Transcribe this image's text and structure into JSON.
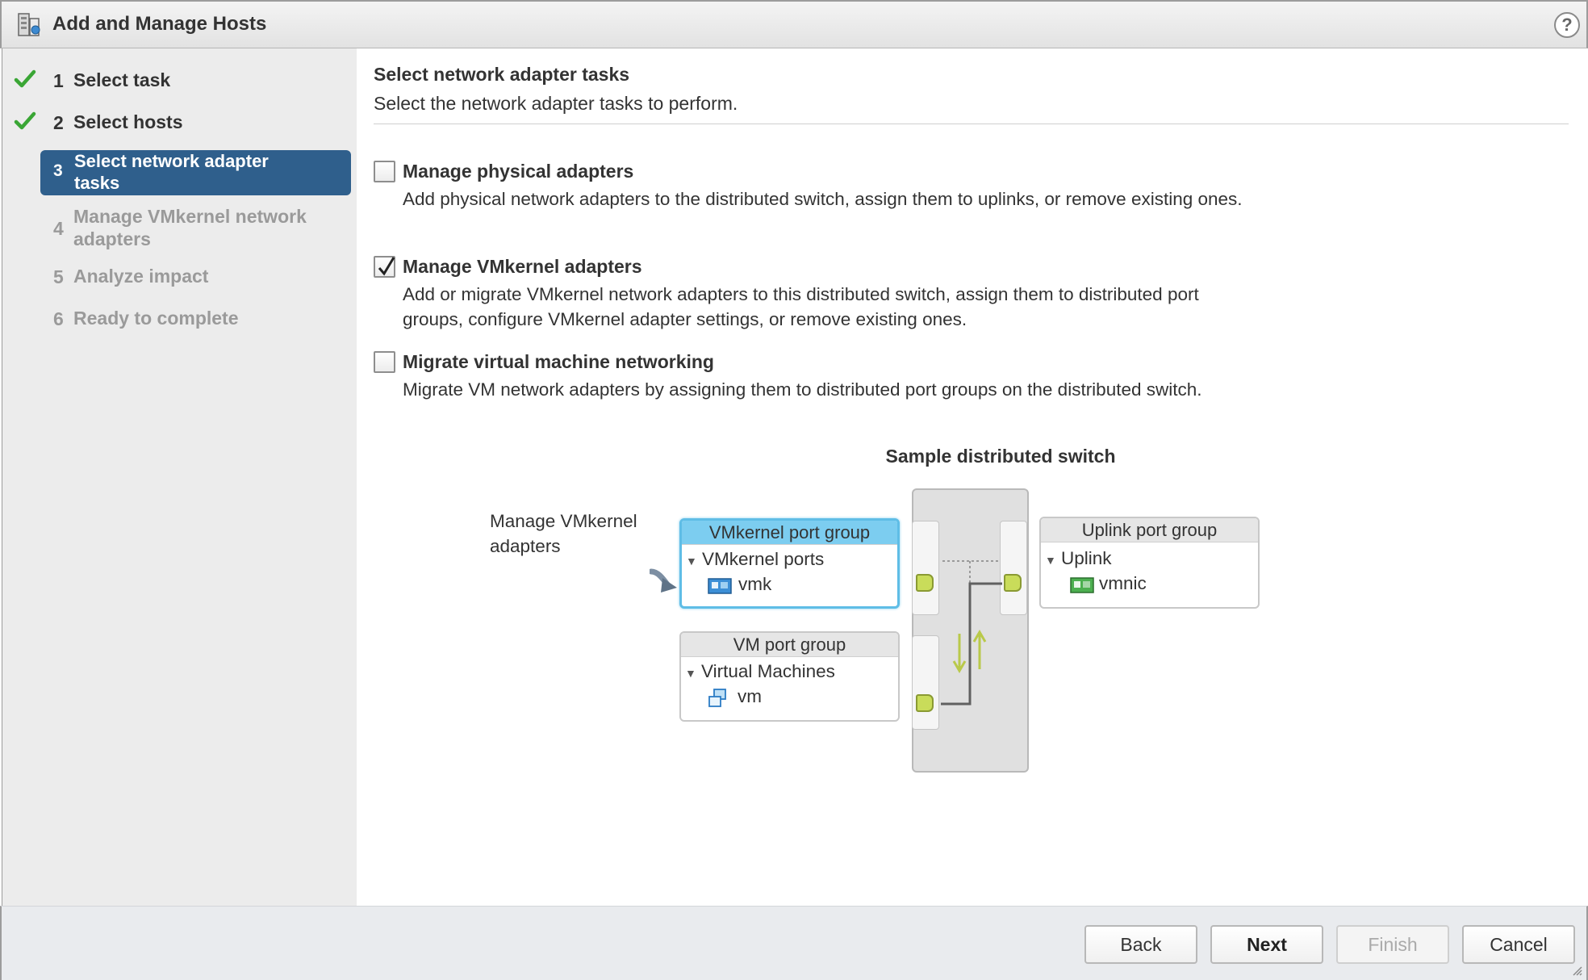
{
  "window": {
    "title": "Add and Manage Hosts",
    "help_label": "?"
  },
  "nav": {
    "steps": [
      {
        "num": "1",
        "label": "Select task",
        "state": "done"
      },
      {
        "num": "2",
        "label": "Select hosts",
        "state": "done"
      },
      {
        "num": "3",
        "label": "Select network adapter tasks",
        "state": "active"
      },
      {
        "num": "4",
        "label": "Manage VMkernel network adapters",
        "state": "pending"
      },
      {
        "num": "5",
        "label": "Analyze impact",
        "state": "pending"
      },
      {
        "num": "6",
        "label": "Ready to complete",
        "state": "pending"
      }
    ]
  },
  "main": {
    "title": "Select network adapter tasks",
    "subtitle": "Select the network adapter tasks to perform.",
    "options": [
      {
        "title": "Manage physical adapters",
        "description": "Add physical network adapters to the distributed switch, assign them to uplinks, or remove existing ones.",
        "checked": false
      },
      {
        "title": "Manage VMkernel adapters",
        "description": "Add or migrate VMkernel network adapters to this distributed switch, assign them to distributed port groups, configure VMkernel adapter settings, or remove existing ones.",
        "checked": true
      },
      {
        "title": "Migrate virtual machine networking",
        "description": "Migrate VM network adapters by assigning them to distributed port groups on the distributed switch.",
        "checked": false
      }
    ],
    "diagram": {
      "title": "Sample distributed switch",
      "note": "Manage VMkernel adapters",
      "vmkernel_group": {
        "header": "VMkernel port group",
        "section": "VMkernel ports",
        "item": "vmk"
      },
      "vm_group": {
        "header": "VM port group",
        "section": "Virtual Machines",
        "item": "vm"
      },
      "uplink_group": {
        "header": "Uplink port group",
        "section": "Uplink",
        "item": "vmnic"
      }
    }
  },
  "footer": {
    "back": "Back",
    "next": "Next",
    "finish": "Finish",
    "cancel": "Cancel"
  },
  "colors": {
    "active_step": "#2f5f8c",
    "check_green": "#3aa635",
    "vmk_highlight": "#7ccdf0",
    "port_green": "#c9dc5a"
  }
}
